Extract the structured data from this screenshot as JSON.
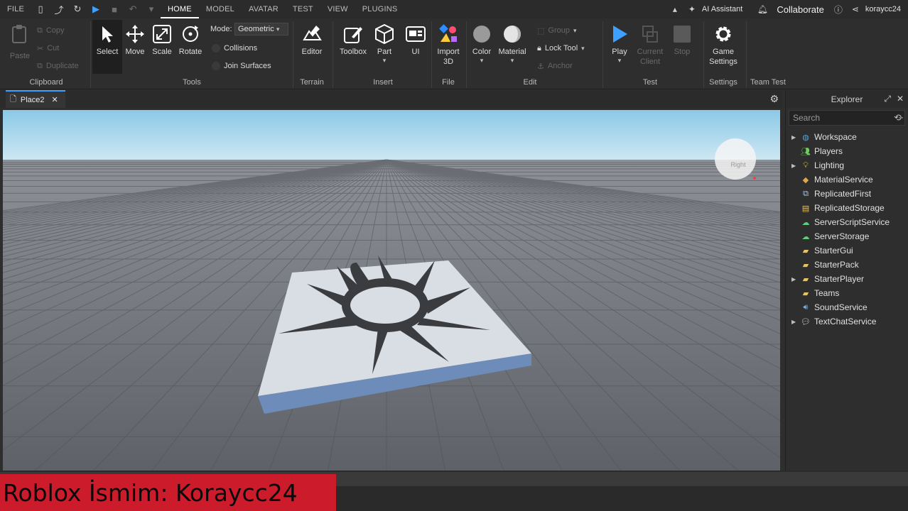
{
  "menubar": {
    "file": "FILE",
    "tabs": [
      "HOME",
      "MODEL",
      "AVATAR",
      "TEST",
      "VIEW",
      "PLUGINS"
    ],
    "active_tab": "HOME",
    "ai_assistant": "AI Assistant",
    "collaborate": "Collaborate",
    "username": "koraycc24"
  },
  "ribbon": {
    "clipboard": {
      "paste": "Paste",
      "copy": "Copy",
      "cut": "Cut",
      "duplicate": "Duplicate",
      "label": "Clipboard"
    },
    "tools": {
      "select": "Select",
      "move": "Move",
      "scale": "Scale",
      "rotate": "Rotate",
      "mode_label": "Mode:",
      "mode_value": "Geometric",
      "collisions": "Collisions",
      "join_surfaces": "Join Surfaces",
      "label": "Tools"
    },
    "terrain": {
      "editor": "Editor",
      "label": "Terrain"
    },
    "insert": {
      "toolbox": "Toolbox",
      "part": "Part",
      "ui": "UI",
      "label": "Insert"
    },
    "file": {
      "import3d": "Import",
      "import3d_2": "3D",
      "label": "File"
    },
    "edit": {
      "color": "Color",
      "material": "Material",
      "group": "Group",
      "lock_tool": "Lock Tool",
      "anchor": "Anchor",
      "label": "Edit"
    },
    "test": {
      "play": "Play",
      "current": "Current",
      "client": "Client",
      "stop": "Stop",
      "label": "Test"
    },
    "settings": {
      "game": "Game",
      "settings": "Settings",
      "label": "Settings"
    },
    "team_test": {
      "label": "Team Test"
    }
  },
  "tabbar": {
    "place_tab": "Place2"
  },
  "viewport": {
    "view_cube_label": "Right"
  },
  "explorer": {
    "title": "Explorer",
    "search_placeholder": "Search",
    "items": [
      {
        "label": "Workspace",
        "expandable": true,
        "icon": "globe-icon"
      },
      {
        "label": "Players",
        "expandable": false,
        "icon": "players-icon"
      },
      {
        "label": "Lighting",
        "expandable": true,
        "icon": "lightbulb-icon"
      },
      {
        "label": "MaterialService",
        "expandable": false,
        "icon": "material-icon"
      },
      {
        "label": "ReplicatedFirst",
        "expandable": false,
        "icon": "replicated-icon"
      },
      {
        "label": "ReplicatedStorage",
        "expandable": false,
        "icon": "storage-icon"
      },
      {
        "label": "ServerScriptService",
        "expandable": false,
        "icon": "server-script-icon"
      },
      {
        "label": "ServerStorage",
        "expandable": false,
        "icon": "server-storage-icon"
      },
      {
        "label": "StarterGui",
        "expandable": false,
        "icon": "folder-icon"
      },
      {
        "label": "StarterPack",
        "expandable": false,
        "icon": "folder-icon"
      },
      {
        "label": "StarterPlayer",
        "expandable": true,
        "icon": "folder-icon"
      },
      {
        "label": "Teams",
        "expandable": false,
        "icon": "folder-icon"
      },
      {
        "label": "SoundService",
        "expandable": false,
        "icon": "sound-icon"
      },
      {
        "label": "TextChatService",
        "expandable": true,
        "icon": "chat-icon"
      }
    ]
  },
  "overlay": {
    "banner_text": "Roblox İsmim: Koraycc24"
  },
  "colors": {
    "accent": "#3ea1ff",
    "banner": "#cc1b2b",
    "sky_top": "#9fd3ee",
    "ground": "#5f636a"
  }
}
